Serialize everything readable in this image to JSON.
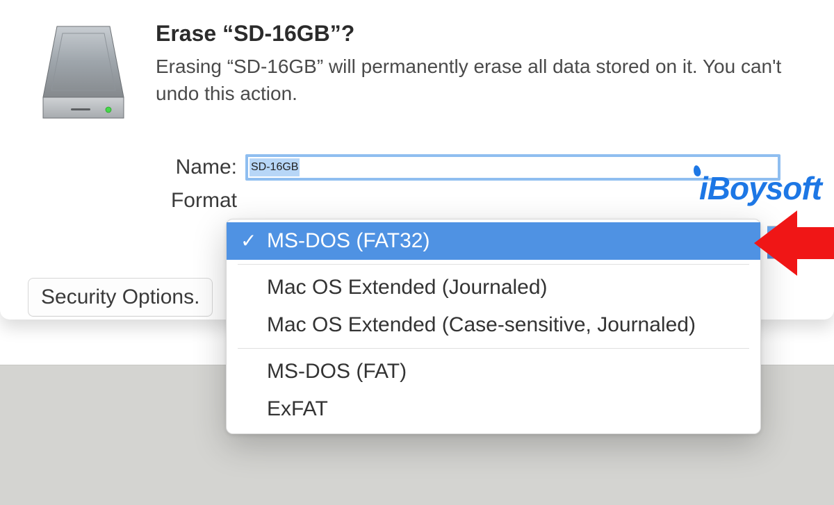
{
  "dialog": {
    "title": "Erase “SD-16GB”?",
    "subtitle": "Erasing “SD-16GB” will permanently erase all data stored on it. You can't undo this action."
  },
  "form": {
    "name_label": "Name:",
    "name_value": "SD-16GB",
    "format_label": "Format"
  },
  "format_dropdown": {
    "selected_index": 0,
    "groups": [
      [
        "MS-DOS (FAT32)"
      ],
      [
        "Mac OS Extended (Journaled)",
        "Mac OS Extended (Case-sensitive, Journaled)"
      ],
      [
        "MS-DOS (FAT)",
        "ExFAT"
      ]
    ]
  },
  "buttons": {
    "security_options": "Security Options."
  },
  "watermark": "iBoysoft",
  "colors": {
    "selection_blue": "#4f92e3",
    "focus_ring": "#8fbef0",
    "arrow_red": "#f01616"
  }
}
